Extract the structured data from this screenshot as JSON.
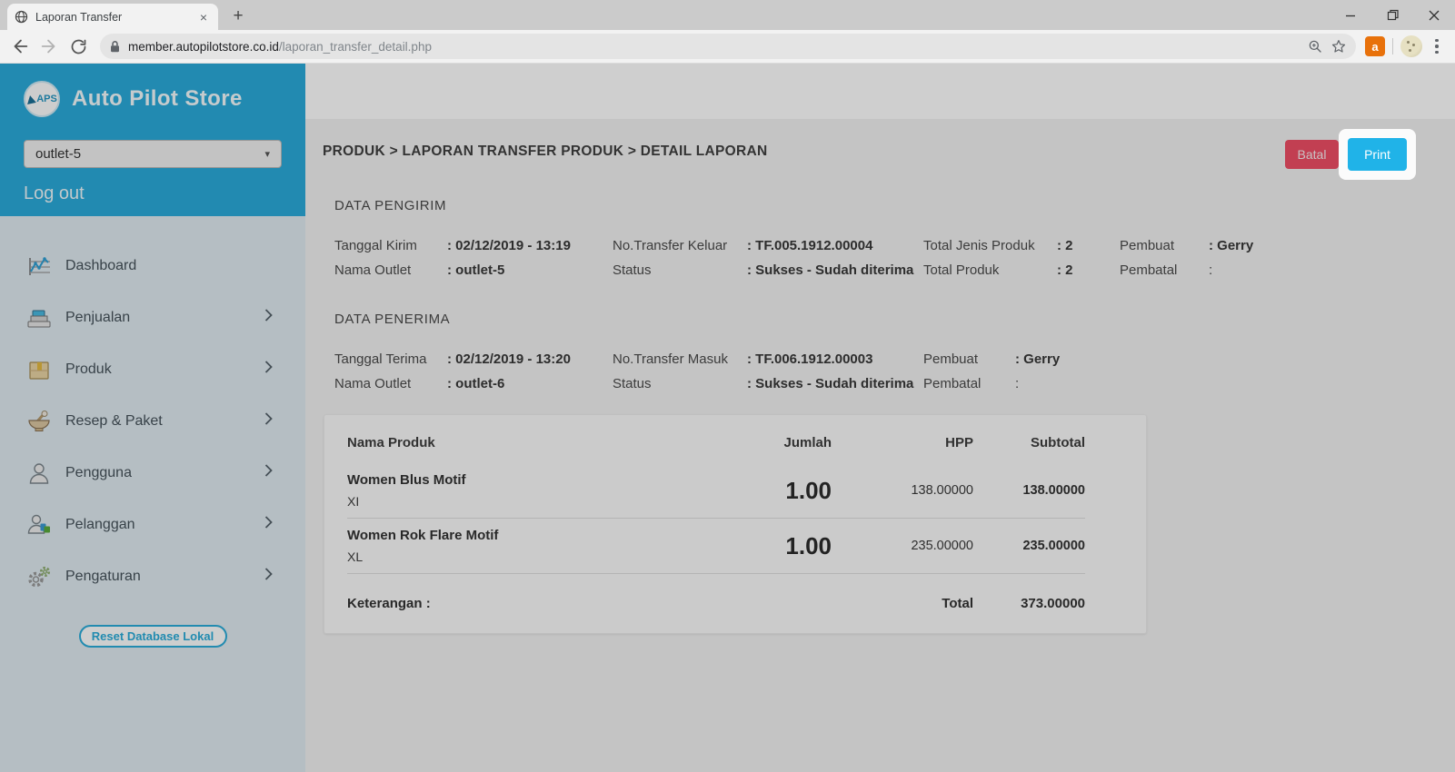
{
  "browser": {
    "tab_title": "Laporan Transfer",
    "url_domain": "member.autopilotstore.co.id",
    "url_path": "/laporan_transfer_detail.php",
    "new_tab_glyph": "+",
    "tab_close_glyph": "×",
    "extension_letter": "a"
  },
  "colors": {
    "sidebar_teal": "#2aabda",
    "sidebar_bg": "#dfeaf0",
    "print_blue": "#20b3e8",
    "batal_red": "#ef4e66",
    "accent_teal": "#2bacd9"
  },
  "icons": {
    "dropdown_caret": "▾"
  },
  "sidebar": {
    "logo_text": "APS",
    "brand": "Auto Pilot Store",
    "outlet_selected": "outlet-5",
    "logout_label": "Log out",
    "menu": [
      {
        "label": "Dashboard"
      },
      {
        "label": "Penjualan"
      },
      {
        "label": "Produk"
      },
      {
        "label": "Resep & Paket"
      },
      {
        "label": "Pengguna"
      },
      {
        "label": "Pelanggan"
      },
      {
        "label": "Pengaturan"
      }
    ],
    "reset_button": "Reset Database Lokal"
  },
  "main": {
    "breadcrumb": "PRODUK > LAPORAN TRANSFER PRODUK > DETAIL LAPORAN",
    "actions": {
      "cancel": "Batal",
      "print": "Print"
    },
    "sender": {
      "title": "DATA PENGIRIM",
      "tanggal_label": "Tanggal Kirim",
      "tanggal_value": ": 02/12/2019 - 13:19",
      "outlet_label": "Nama Outlet",
      "outlet_value": ": outlet-5",
      "transfer_label": "No.Transfer Keluar",
      "transfer_value": ": TF.005.1912.00004",
      "status_label": "Status",
      "status_value": ": Sukses - Sudah diterima",
      "jenis_label": "Total Jenis Produk",
      "jenis_value": ": 2",
      "total_label": "Total Produk",
      "total_value": ": 2",
      "pembuat_label": "Pembuat",
      "pembuat_value": ": Gerry",
      "pembatal_label": "Pembatal",
      "pembatal_value": ":"
    },
    "receiver": {
      "title": "DATA PENERIMA",
      "tanggal_label": "Tanggal Terima",
      "tanggal_value": ": 02/12/2019 - 13:20",
      "outlet_label": "Nama Outlet",
      "outlet_value": ": outlet-6",
      "transfer_label": "No.Transfer Masuk",
      "transfer_value": ": TF.006.1912.00003",
      "status_label": "Status",
      "status_value": ": Sukses - Sudah diterima",
      "pembuat_label": "Pembuat",
      "pembuat_value": ": Gerry",
      "pembatal_label": "Pembatal",
      "pembatal_value": ":"
    },
    "table": {
      "headers": {
        "name": "Nama Produk",
        "qty": "Jumlah",
        "hpp": "HPP",
        "subtotal": "Subtotal"
      },
      "rows": [
        {
          "name": "Women Blus Motif",
          "variant": "XI",
          "qty": "1.00",
          "hpp": "138.00000",
          "subtotal": "138.00000"
        },
        {
          "name": "Women Rok Flare Motif",
          "variant": "XL",
          "qty": "1.00",
          "hpp": "235.00000",
          "subtotal": "235.00000"
        }
      ],
      "footer": {
        "keterangan": "Keterangan :",
        "total_label": "Total",
        "total_value": "373.00000"
      }
    }
  }
}
